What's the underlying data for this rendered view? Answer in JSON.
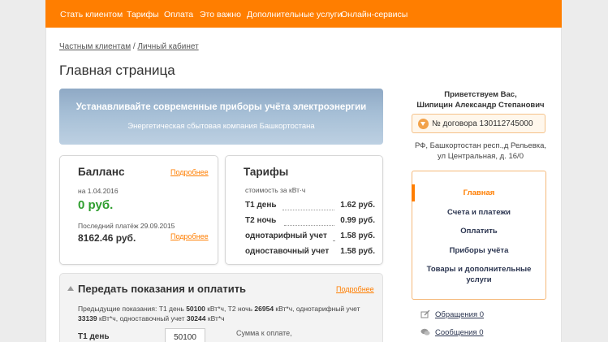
{
  "topnav": [
    "Стать клиентом",
    "Тарифы",
    "Оплата",
    "Это важно",
    "Дополнительные услуги",
    "Онлайн-сервисы"
  ],
  "breadcrumb": {
    "part1": "Частным клиентам",
    "sep": " / ",
    "part2": "Личный кабинет"
  },
  "page_title": "Главная страница",
  "banner": {
    "headline": "Устанавливайте современные приборы учёта электроэнергии",
    "subline": "Энергетическая сбытовая компания Башкортостана"
  },
  "balance": {
    "title": "Балланс",
    "more": "Подробнее",
    "date": "на 1.04.2016",
    "amount": "0 руб.",
    "last_payment_label": "Последний платёж 29.09.2015",
    "last_payment_amount": "8162.46 руб.",
    "more2": "Подробнее"
  },
  "tariffs": {
    "title": "Тарифы",
    "subtitle": "стоимость за кВт·ч",
    "rows": [
      {
        "label": "Т1 день",
        "value": "1.62 руб."
      },
      {
        "label": "Т2 ночь",
        "value": "0.99 руб."
      },
      {
        "label": "однотарифный учет",
        "value": "1.58 руб."
      },
      {
        "label": "одноставочный учет",
        "value": "1.58 руб."
      }
    ]
  },
  "submit": {
    "title": "Передать показания и оплатить",
    "more": "Подробнее",
    "prev_label": "Предыдущие показания: Т1 день ",
    "prev_t1": "50100",
    "prev_unit": " кВт*ч, Т2 ночь ",
    "prev_t2": "26954",
    "prev_unit2": " кВт*ч, однотарифный учет ",
    "prev_single": "33139",
    "prev_unit3": " кВт*ч, одноставочный учет ",
    "prev_rate": "30244",
    "prev_unit4": " кВт*ч",
    "t1_label": "Т1 день",
    "t1_value": "50100",
    "sum_label": "Сумма к оплате,"
  },
  "user": {
    "greeting": "Приветствуем Вас,",
    "name": "Шипицин Александр Степанович",
    "contract": "№ договора 130112745000",
    "address": "РФ, Башкортостан респ.,д Рельевка, ул Центральная, д. 16/0"
  },
  "side_menu": [
    "Главная",
    "Счета и платежи",
    "Оплатить",
    "Приборы учёта",
    "Товары и дополнительные услуги"
  ],
  "side_links": [
    {
      "label": "Обращения 0",
      "icon": "pencil-icon"
    },
    {
      "label": "Сообщения 0",
      "icon": "chat-bubble-icon"
    }
  ],
  "colors": {
    "accent": "#ff7e00",
    "green": "#2e9e2e",
    "nav_text": "#2b3550"
  }
}
